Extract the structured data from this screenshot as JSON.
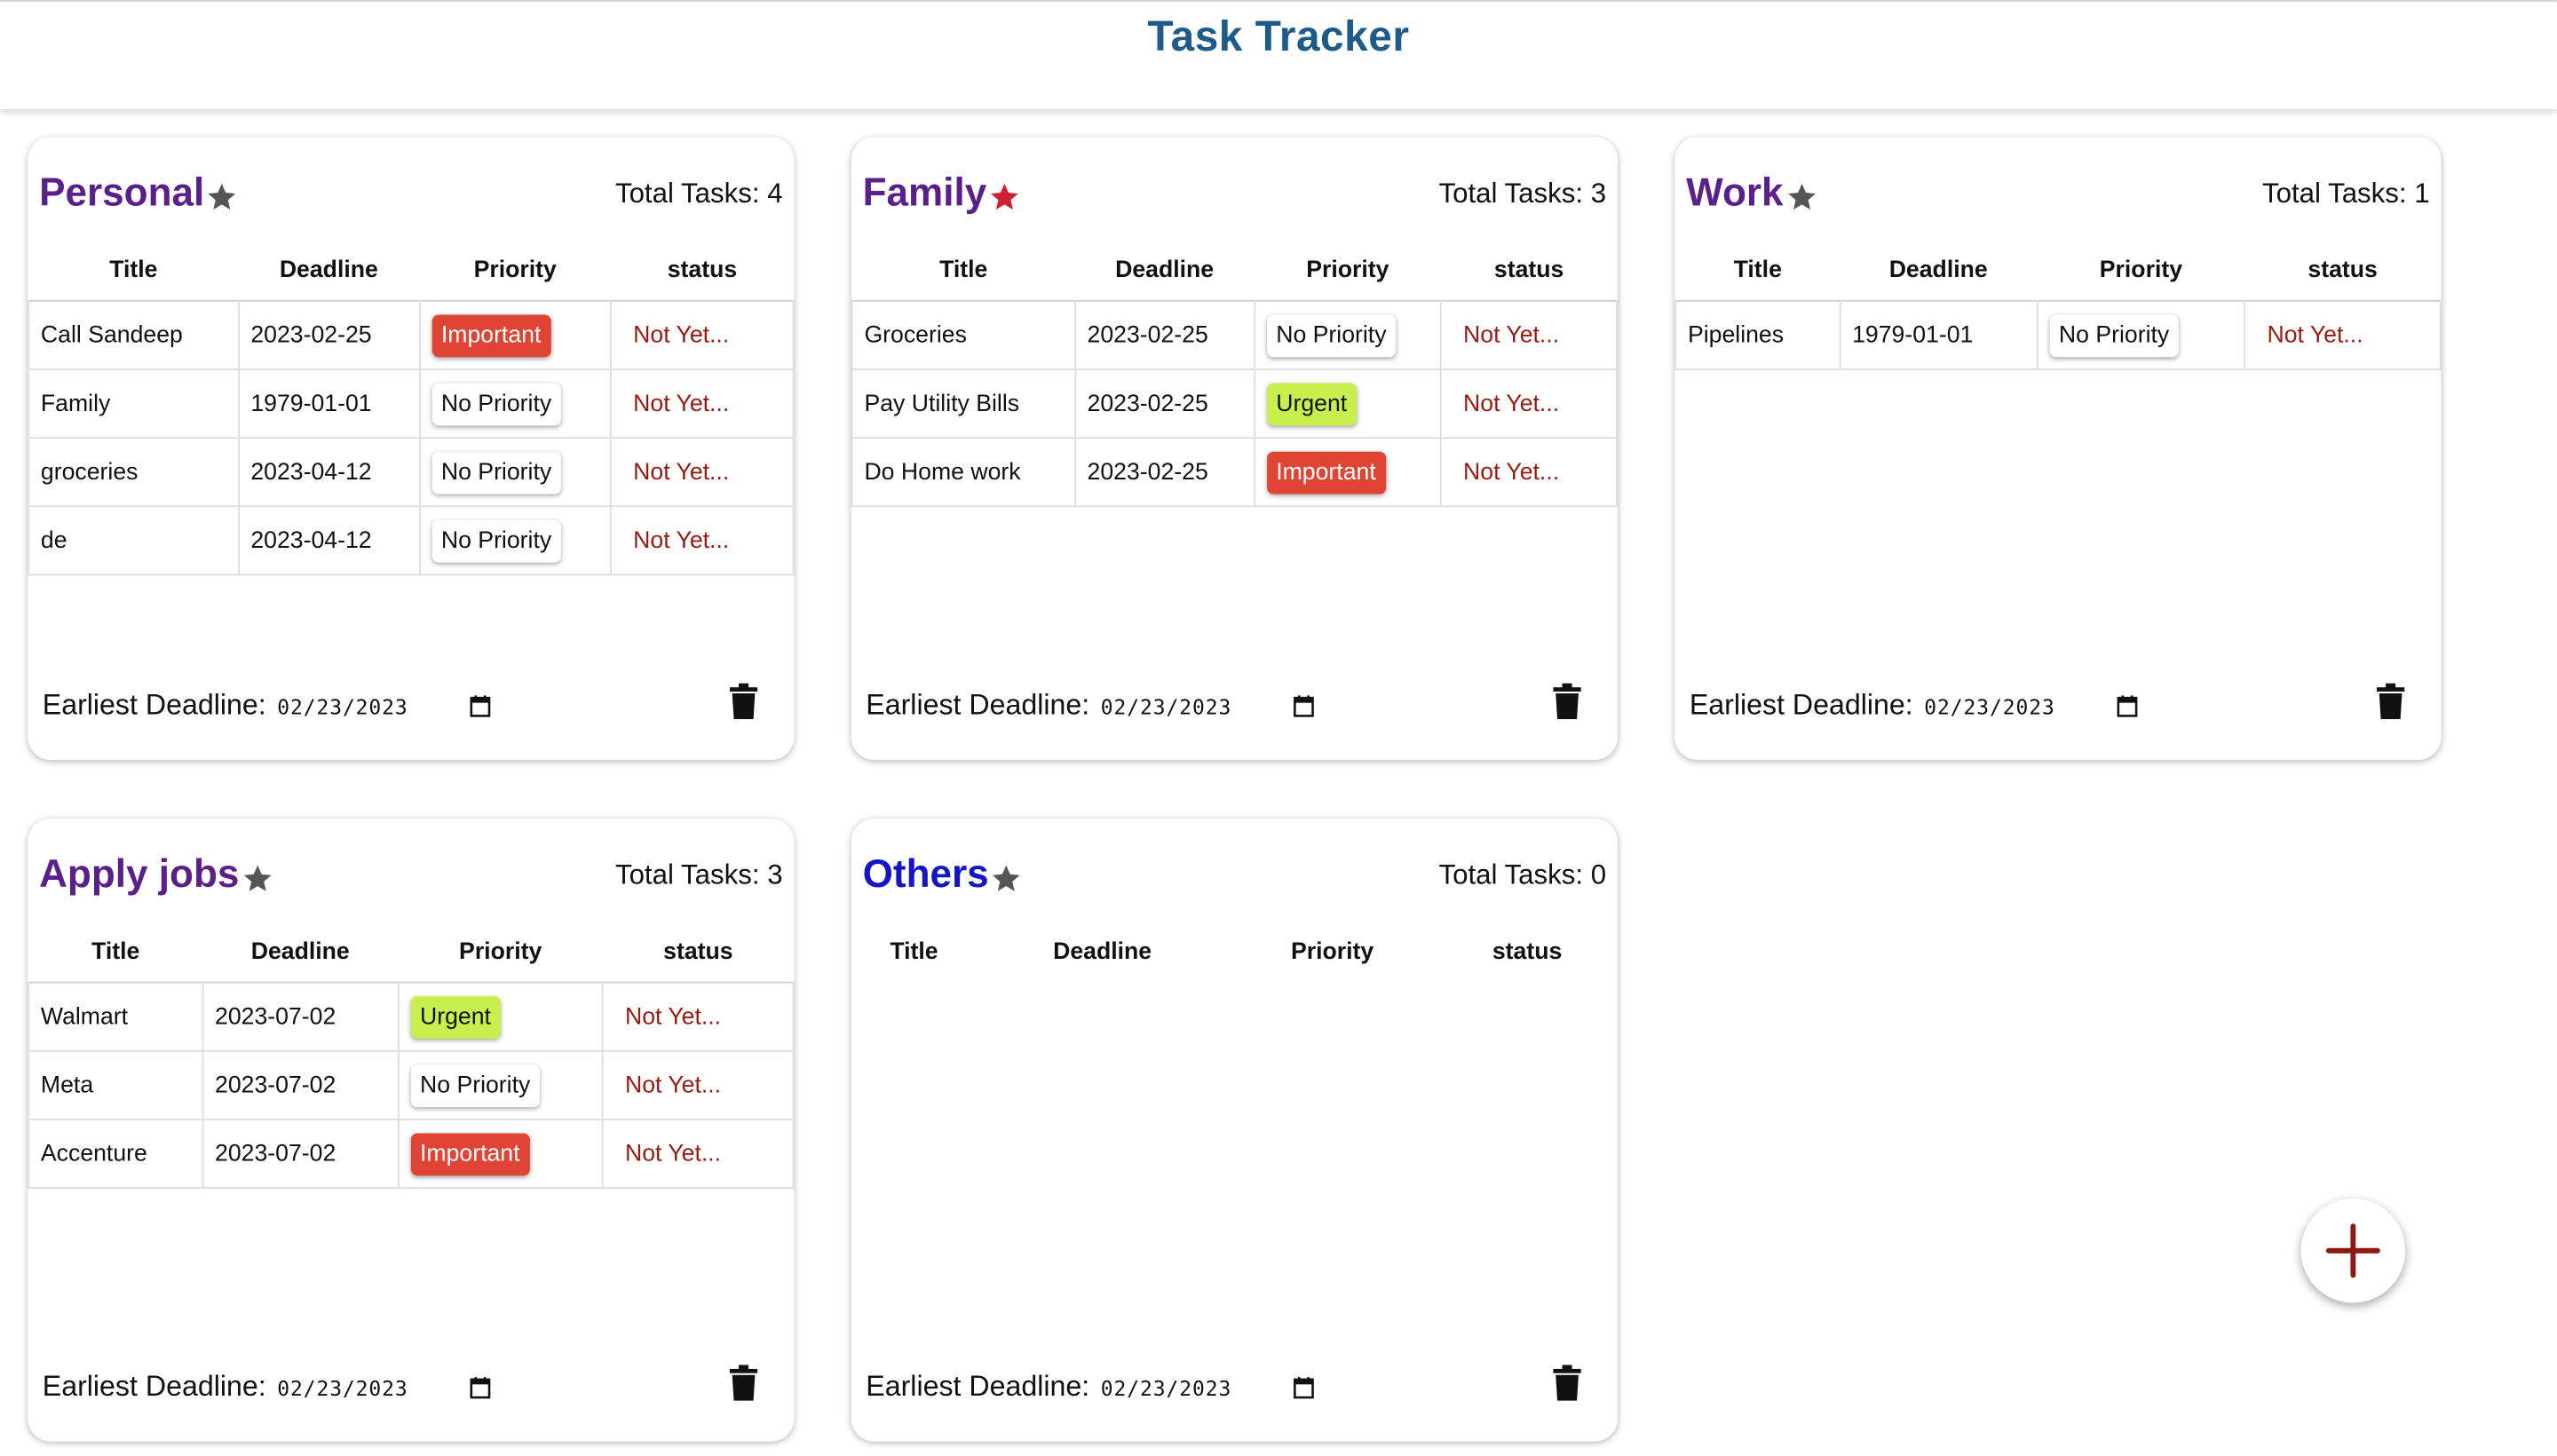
{
  "app": {
    "title": "Task Tracker"
  },
  "table_headers": {
    "title": "Title",
    "deadline": "Deadline",
    "priority": "Priority",
    "status": "status"
  },
  "footer": {
    "label": "Earliest Deadline:",
    "date": "02/23/2023"
  },
  "total_label": "Total Tasks:",
  "priority_colors": {
    "Important": "#e04434",
    "Urgent": "#c9ef4f",
    "No Priority": "#ffffff"
  },
  "star_colors": {
    "default": "#555555",
    "favorite": "#cc2233"
  },
  "categories": [
    {
      "name": "Personal",
      "starred": false,
      "total": "4",
      "tasks": [
        {
          "title": "Call Sandeep",
          "deadline": "2023-02-25",
          "priority": "Important",
          "status": "Not Yet..."
        },
        {
          "title": "Family",
          "deadline": "1979-01-01",
          "priority": "No Priority",
          "status": "Not Yet..."
        },
        {
          "title": "groceries",
          "deadline": "2023-04-12",
          "priority": "No Priority",
          "status": "Not Yet..."
        },
        {
          "title": "de",
          "deadline": "2023-04-12",
          "priority": "No Priority",
          "status": "Not Yet..."
        }
      ]
    },
    {
      "name": "Family",
      "starred": true,
      "total": "3",
      "tasks": [
        {
          "title": "Groceries",
          "deadline": "2023-02-25",
          "priority": "No Priority",
          "status": "Not Yet..."
        },
        {
          "title": "Pay Utility Bills",
          "deadline": "2023-02-25",
          "priority": "Urgent",
          "status": "Not Yet..."
        },
        {
          "title": "Do Home work",
          "deadline": "2023-02-25",
          "priority": "Important",
          "status": "Not Yet..."
        }
      ]
    },
    {
      "name": "Work",
      "starred": false,
      "total": "1",
      "tasks": [
        {
          "title": "Pipelines",
          "deadline": "1979-01-01",
          "priority": "No Priority",
          "status": "Not Yet..."
        }
      ]
    },
    {
      "name": "Apply jobs",
      "starred": false,
      "total": "3",
      "tasks": [
        {
          "title": "Walmart",
          "deadline": "2023-07-02",
          "priority": "Urgent",
          "status": "Not Yet..."
        },
        {
          "title": "Meta",
          "deadline": "2023-07-02",
          "priority": "No Priority",
          "status": "Not Yet..."
        },
        {
          "title": "Accenture",
          "deadline": "2023-07-02",
          "priority": "Important",
          "status": "Not Yet..."
        }
      ]
    },
    {
      "name": "Others",
      "starred": false,
      "total": "0",
      "tasks": []
    }
  ],
  "fab": {
    "icon": "plus-icon"
  }
}
